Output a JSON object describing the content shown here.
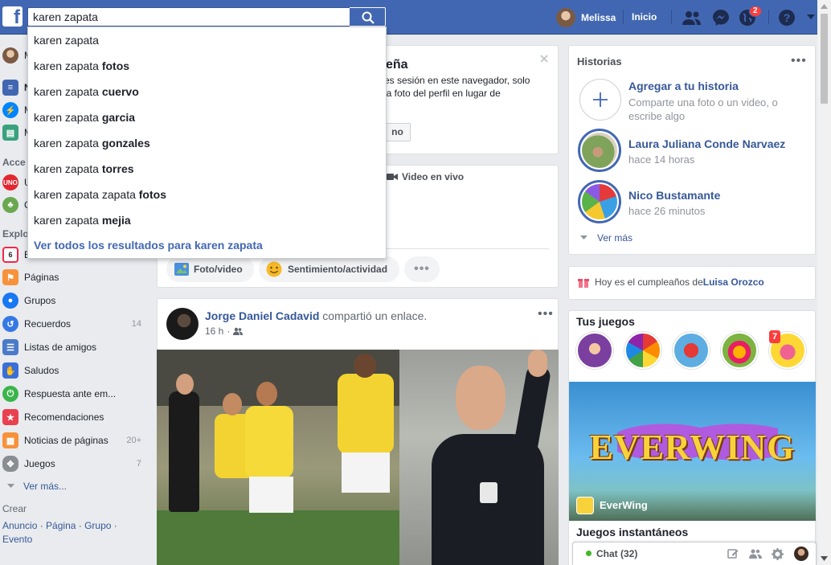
{
  "topbar": {
    "logo": "f",
    "search_value": "karen zapata",
    "user_name": "Melissa",
    "home_label": "Inicio",
    "notif_count": "2"
  },
  "autocomplete": {
    "items": [
      {
        "base": "karen zapata",
        "bold": ""
      },
      {
        "base": "karen zapata ",
        "bold": "fotos"
      },
      {
        "base": "karen zapata ",
        "bold": "cuervo"
      },
      {
        "base": "karen zapata ",
        "bold": "garcia"
      },
      {
        "base": "karen zapata ",
        "bold": "gonzales"
      },
      {
        "base": "karen zapata ",
        "bold": "torres"
      },
      {
        "base": "karen zapata zapata ",
        "bold": "fotos"
      },
      {
        "base": "karen zapata ",
        "bold": "mejia"
      }
    ],
    "see_all": "Ver todos los resultados para karen zapata"
  },
  "sidebar": {
    "profile_initial": "M",
    "top_items": [
      {
        "label": "N",
        "icon": "news-feed-icon"
      },
      {
        "label": "M",
        "icon": "messenger-icon"
      },
      {
        "label": "M",
        "icon": "marketplace-icon"
      }
    ],
    "shortcuts_title": "Acce",
    "shortcuts": [
      {
        "label": "U",
        "icon": "uno-game-icon"
      },
      {
        "label": "C",
        "icon": "tree-icon"
      }
    ],
    "explore_title": "Explo",
    "explore": [
      {
        "label": "E",
        "count": "",
        "icon": "calendar-icon",
        "color": "#f02849"
      },
      {
        "label": "Páginas",
        "count": "",
        "icon": "flag-icon",
        "color": "#f7923b"
      },
      {
        "label": "Grupos",
        "count": "",
        "icon": "groups-icon",
        "color": "#1877f2"
      },
      {
        "label": "Recuerdos",
        "count": "14",
        "icon": "memories-icon",
        "color": "#3578e5"
      },
      {
        "label": "Listas de amigos",
        "count": "",
        "icon": "friend-lists-icon",
        "color": "#4b7ac9"
      },
      {
        "label": "Saludos",
        "count": "",
        "icon": "wave-icon",
        "color": "#3b6fd8"
      },
      {
        "label": "Respuesta ante em...",
        "count": "",
        "icon": "crisis-response-icon",
        "color": "#3ab54a"
      },
      {
        "label": "Recomendaciones",
        "count": "",
        "icon": "recommendations-icon",
        "color": "#e9414f"
      },
      {
        "label": "Noticias de páginas",
        "count": "20+",
        "icon": "pages-feed-icon",
        "color": "#f7923b"
      },
      {
        "label": "Juegos",
        "count": "7",
        "icon": "games-controller-icon",
        "color": "#8a8d91"
      }
    ],
    "see_more": "Ver más...",
    "create_title": "Crear",
    "create_links": [
      "Anuncio",
      "Página",
      "Grupo",
      "Evento"
    ]
  },
  "tip_card": {
    "title": "eña",
    "text": "es sesión en este navegador, solo la foto del perfil en lugar de",
    "button": "no"
  },
  "composer": {
    "live_video": "Video en vivo",
    "photo_video": "Foto/video",
    "feeling": "Sentimiento/actividad"
  },
  "post": {
    "author": "Jorge Daniel Cadavid",
    "action": "compartió un enlace.",
    "time": "16 h"
  },
  "stories": {
    "title": "Historias",
    "add_title": "Agregar a tu historia",
    "add_sub": "Comparte una foto o un video, o escribe algo",
    "items": [
      {
        "name": "Laura Juliana Conde Narvaez",
        "time": "hace 14 horas"
      },
      {
        "name": "Nico Bustamante",
        "time": "hace 26 minutos"
      }
    ],
    "see_more": "Ver más"
  },
  "birthday": {
    "prefix": "Hoy es el cumpleaños de ",
    "name": "Luisa Orozco"
  },
  "games": {
    "title": "Tus juegos",
    "badge": "7",
    "featured_logo": "EVERWING",
    "featured_name": "EverWing",
    "instant_title": "Juegos instantáneos"
  },
  "chat": {
    "label": "Chat (32)",
    "status_color": "#42b72a"
  },
  "colors": {
    "brand": "#4267b2",
    "link": "#365899",
    "background": "#e9ebee"
  }
}
